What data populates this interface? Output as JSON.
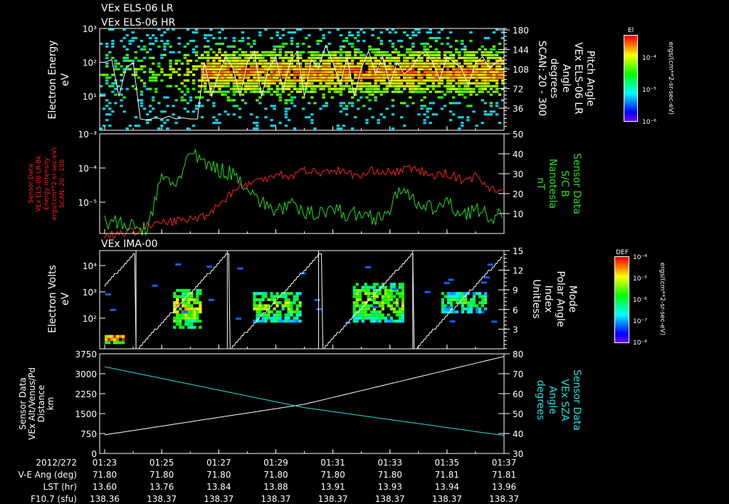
{
  "titles": {
    "top1": "VEx ELS-06 LR",
    "top2": "VEx ELS-06 HR",
    "ima": "VEx IMA-00"
  },
  "colors": {
    "red": "#ff2020",
    "green": "#20e020",
    "cyan": "#20e0e0",
    "white": "#ffffff"
  },
  "chart_data": [
    {
      "type": "heatmap",
      "name": "els-spectrogram",
      "ylabel": [
        "Electron Energy",
        "eV"
      ],
      "yticks": [
        "10³",
        "10²",
        "10¹"
      ],
      "ylim_log": [
        0.1,
        3
      ],
      "right_label": [
        "Pitch Angle",
        "VEx ELS-06 LR",
        "Angle",
        "degrees",
        "SCAN: 20 - 300"
      ],
      "right_ticks": [
        "180",
        "144",
        "108",
        "72",
        "36"
      ],
      "right_lim": [
        0,
        180
      ],
      "colorbar": {
        "title": "El",
        "ticks": [
          "10⁻⁴",
          "10⁻⁵",
          "10⁻⁶"
        ],
        "unit": "ergs/(cm**2-sr-sec-eV)"
      },
      "pitch_angle_line": [
        120,
        125,
        60,
        110,
        120,
        20,
        18,
        22,
        20,
        25,
        20,
        22,
        20,
        20,
        120,
        60,
        100,
        130,
        110,
        60,
        120,
        140,
        60,
        110,
        130,
        70,
        120,
        140,
        60,
        125,
        110,
        150,
        120,
        80,
        130,
        60,
        110,
        140,
        100,
        130,
        80,
        120,
        100,
        110,
        130,
        140,
        120,
        90,
        130,
        120,
        110,
        80,
        120,
        130,
        110,
        120,
        130
      ]
    },
    {
      "type": "line",
      "name": "intensity-and-field",
      "ylabel": [
        "Sensor Data",
        "VEx ELS-06 LR-Bk",
        "Energy Intensity",
        "ergs/(cm**2-sr-sec-eV)",
        "SCAN: 20 - 150"
      ],
      "yticks": [
        "10⁻³",
        "10⁻⁴",
        "10⁻⁵"
      ],
      "right_label": [
        "Sensor Data",
        "S/C B",
        "Nanotesla",
        "nT"
      ],
      "right_ticks": [
        "50",
        "40",
        "30",
        "20",
        "10"
      ],
      "right_lim": [
        0,
        50
      ],
      "x_minutes": [
        0,
        0.5,
        1,
        1.5,
        2,
        2.5,
        3,
        3.5,
        4,
        4.5,
        5,
        5.5,
        6,
        6.5,
        7,
        7.5,
        8,
        8.5,
        9,
        9.5,
        10,
        10.5,
        11,
        11.5,
        12,
        12.5,
        13,
        13.5,
        14
      ],
      "series": [
        {
          "name": "Energy Intensity",
          "color": "red",
          "log10_values": [
            -5.85,
            -5.8,
            -5.75,
            -5.6,
            -5.5,
            -5.45,
            -5.4,
            -5.3,
            -5.0,
            -4.6,
            -4.4,
            -4.3,
            -4.1,
            -4.2,
            -4.0,
            -4.1,
            -4.0,
            -4.1,
            -4.2,
            -4.0,
            -4.1,
            -4.0,
            -4.0,
            -4.2,
            -4.1,
            -4.3,
            -4.2,
            -4.5,
            -4.6
          ]
        },
        {
          "name": "S/C B",
          "color": "green",
          "values": [
            6,
            5,
            3,
            2,
            28,
            25,
            40,
            35,
            32,
            30,
            24,
            15,
            12,
            14,
            10,
            11,
            13,
            9,
            10,
            8,
            12,
            25,
            12,
            13,
            15,
            10,
            12,
            8,
            9
          ]
        }
      ]
    },
    {
      "type": "heatmap",
      "name": "ima-spectrogram",
      "title": "VEx IMA-00",
      "ylabel": [
        "Electron Volts",
        "eV"
      ],
      "yticks": [
        "10⁴",
        "10³",
        "10²"
      ],
      "right_label": [
        "Mode",
        "Polar Angle",
        "Index",
        "Unitless"
      ],
      "right_ticks": [
        "15",
        "12",
        "9",
        "6",
        "3"
      ],
      "right_lim": [
        0,
        15
      ],
      "colorbar": {
        "title": "DEF",
        "ticks": [
          "10⁻⁴",
          "10⁻⁵",
          "10⁻⁶",
          "10⁻⁷",
          "10⁻⁸"
        ],
        "unit": "ergs/(cm**2-sr-sec-eV)"
      },
      "mode_resets_minutes": [
        1.1,
        4.3,
        7.5,
        10.8
      ],
      "clusters": [
        {
          "t": [
            0,
            0.7
          ],
          "log_e": [
            1.3,
            1.6
          ],
          "level": 0.9
        },
        {
          "t": [
            2.4,
            3.4
          ],
          "log_e": [
            1.8,
            3.1
          ],
          "level": 0.7
        },
        {
          "t": [
            5.2,
            6.8
          ],
          "log_e": [
            2.0,
            3.0
          ],
          "level": 0.6
        },
        {
          "t": [
            8.7,
            10.4
          ],
          "log_e": [
            2.0,
            3.3
          ],
          "level": 0.65
        },
        {
          "t": [
            11.8,
            13.3
          ],
          "log_e": [
            2.3,
            3.0
          ],
          "level": 0.5
        }
      ]
    },
    {
      "type": "line",
      "name": "altitude-sza",
      "ylabel": [
        "Sensor Data",
        "VEx Alt/Venus/Pd",
        "Distance",
        "km"
      ],
      "yticks": [
        "3750",
        "3000",
        "2250",
        "1500",
        "750",
        "0"
      ],
      "ylim": [
        0,
        3750
      ],
      "right_label": [
        "Sensor Data",
        "VEx SZA",
        "Angle",
        "degrees"
      ],
      "right_ticks": [
        "80",
        "70",
        "60",
        "50",
        "40",
        "30"
      ],
      "right_lim": [
        30,
        80
      ],
      "series": [
        {
          "name": "Altitude",
          "color": "white",
          "x_minutes": [
            0,
            7,
            14
          ],
          "values": [
            700,
            1850,
            3650
          ]
        },
        {
          "name": "SZA",
          "color": "cyan",
          "x_minutes": [
            0,
            7,
            14
          ],
          "values": [
            73.5,
            53,
            39
          ]
        }
      ]
    }
  ],
  "table": {
    "row_labels": [
      "2012/272",
      "V-E Ang (deg)",
      "LST (hr)",
      "F10.7 (sfu)"
    ],
    "columns": [
      [
        "01:23",
        "71.80",
        "13.60",
        "138.36"
      ],
      [
        "01:25",
        "71.80",
        "13.76",
        "138.37"
      ],
      [
        "01:27",
        "71.80",
        "13.84",
        "138.37"
      ],
      [
        "01:29",
        "71.80",
        "13.88",
        "138.37"
      ],
      [
        "01:31",
        "71.80",
        "13.91",
        "138.37"
      ],
      [
        "01:33",
        "71.80",
        "13.93",
        "138.37"
      ],
      [
        "01:35",
        "71.81",
        "13.94",
        "138.37"
      ],
      [
        "01:37",
        "71.81",
        "13.96",
        "138.37"
      ]
    ]
  }
}
